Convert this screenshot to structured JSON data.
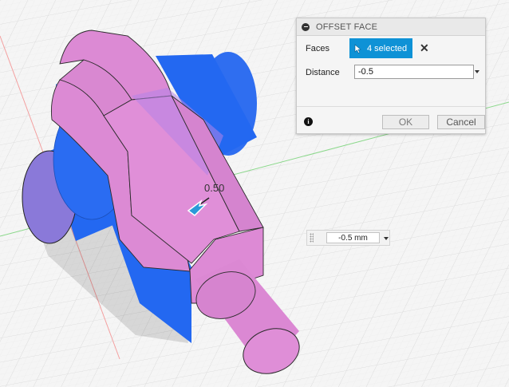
{
  "dialog": {
    "title": "OFFSET FACE",
    "faces_label": "Faces",
    "faces_selection": "4 selected",
    "distance_label": "Distance",
    "distance_value": "-0.5",
    "ok_label": "OK",
    "cancel_label": "Cancel"
  },
  "canvas": {
    "offset_dimension_label": "0.50",
    "float_value": "-0.5 mm"
  },
  "colors": {
    "selected_face": "#db88d3",
    "body_blue": "#2368f1",
    "accent_button": "#0e92d6"
  },
  "icons": [
    "collapse-icon",
    "cursor-arrow-icon",
    "clear-selection-icon",
    "info-icon",
    "dropdown-arrow-icon",
    "offset-drag-arrow-icon",
    "drag-grip-icon"
  ]
}
